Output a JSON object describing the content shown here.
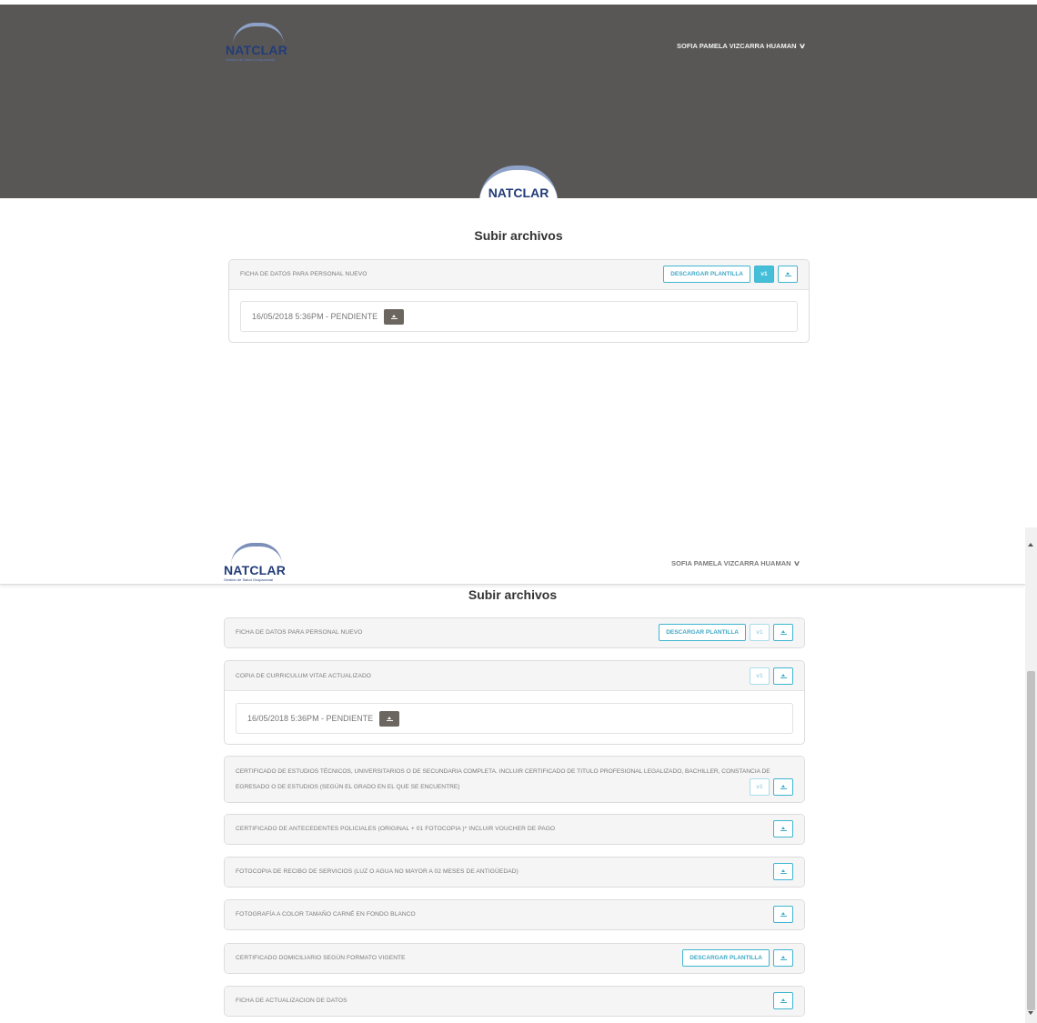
{
  "brand": {
    "name": "NATCLAR",
    "tagline": "Gestión de Salud Ocupacional"
  },
  "user": {
    "name": "SOFIA PAMELA VIZCARRA HUAMAN"
  },
  "page_title": "Subir archivos",
  "icons": {
    "chevron": "chevron-down-icon",
    "upload": "upload-icon",
    "download": "download-icon"
  },
  "colors": {
    "header_bg": "#585756",
    "accent": "#45bfd9",
    "brand": "#233c78",
    "download_btn": "#6b6660"
  },
  "labels": {
    "download_template": "DESCARGAR PLANTILLA",
    "version_badge": "v1"
  },
  "screen1": {
    "doc_title": "FICHA DE DATOS PARA PERSONAL NUEVO",
    "file_entry": "16/05/2018 5:36PM - PENDIENTE"
  },
  "screen2": {
    "documents": [
      {
        "title": "FICHA DE DATOS PARA PERSONAL NUEVO"
      },
      {
        "title": "COPIA DE CURRICULUM VITAE ACTUALIZADO",
        "file_entry": "16/05/2018 5:36PM - PENDIENTE"
      },
      {
        "title": "CERTIFICADO DE ESTUDIOS TÉCNICOS, UNIVERSITARIOS O DE SECUNDARIA COMPLETA. INCLUIR CERTIFICADO DE TITULO PROFESIONAL LEGALIZADO, BACHILLER, CONSTANCIA DE EGRESADO O DE ESTUDIOS (SEGÚN EL GRADO EN EL QUE SE ENCUENTRE)"
      },
      {
        "title": "CERTIFICADO DE ANTECEDENTES POLICIALES (ORIGINAL + 01 FOTOCOPIA )* INCLUIR VOUCHER DE PAGO"
      },
      {
        "title": "FOTOCOPIA DE RECIBO DE SERVICIOS (LUZ O AGUA NO MAYOR A 02 MESES DE ANTIGÜEDAD)"
      },
      {
        "title": "FOTOGRAFÍA A COLOR TAMAÑO CARNÉ EN FONDO BLANCO"
      },
      {
        "title": "CERTIFICADO DOMICILIARIO SEGÚN FORMATO VIGENTE"
      },
      {
        "title": "FICHA DE ACTUALIZACION DE DATOS"
      }
    ]
  }
}
